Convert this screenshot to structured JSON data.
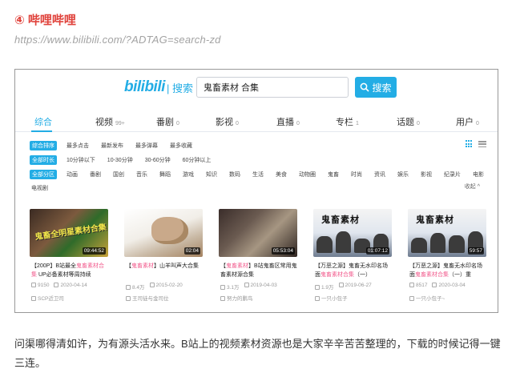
{
  "heading": "④ 哔哩哔哩",
  "url": "https://www.bilibili.com/?ADTAG=search-zd",
  "bilibili": {
    "logo": "bilibili",
    "logo_suffix": "| 搜索",
    "search": {
      "value": "鬼畜素材 合集",
      "button": "搜索"
    },
    "tabs": [
      {
        "label": "综合",
        "count": ""
      },
      {
        "label": "视频",
        "count": "99+"
      },
      {
        "label": "番剧",
        "count": "0"
      },
      {
        "label": "影视",
        "count": "0"
      },
      {
        "label": "直播",
        "count": "0"
      },
      {
        "label": "专栏",
        "count": "1"
      },
      {
        "label": "话题",
        "count": "0"
      },
      {
        "label": "用户",
        "count": "0"
      }
    ],
    "sort": [
      "综合排序",
      "最多点击",
      "最新发布",
      "最多弹幕",
      "最多收藏"
    ],
    "duration": [
      "全部时长",
      "10分钟以下",
      "10-30分钟",
      "30-60分钟",
      "60分钟以上"
    ],
    "zones": [
      "全部分区",
      "动画",
      "番剧",
      "国创",
      "音乐",
      "舞蹈",
      "游戏",
      "知识",
      "数码",
      "生活",
      "美食",
      "动物圈",
      "鬼畜",
      "时尚",
      "资讯",
      "娱乐",
      "影视",
      "纪录片",
      "电影"
    ],
    "more_zone": "电视剧",
    "collapse": "收起 ^",
    "videos": [
      {
        "title_pre": "【200P】B站最全",
        "title_hl": "鬼畜素材合集",
        "title_post": " UP必备素材等周持续",
        "duration": "09:44:52",
        "views": "9150",
        "date": "2020-04-14",
        "uploader": "SCP近卫司",
        "overlay": "鬼畜全明星素材合集"
      },
      {
        "title_pre": "【",
        "title_hl": "鬼畜素材",
        "title_post": "】山羊叫声大合集",
        "duration": "02:04",
        "views": "8.4万",
        "date": "2015-02-20",
        "uploader": "王司徒与金司位"
      },
      {
        "title_pre": "【",
        "title_hl": "鬼畜素材",
        "title_post": "】B站鬼畜区常用鬼畜素材源合集",
        "duration": "05:53:04",
        "views": "3.1万",
        "date": "2019-04-03",
        "uploader": "努力的鹏鸟"
      },
      {
        "title_pre": "【万恶之源】鬼畜无水印名场面",
        "title_hl": "鬼畜素材合集",
        "title_post": "（一）",
        "duration": "01:07:12",
        "views": "1.9万",
        "date": "2019-06-27",
        "uploader": "一只小包子",
        "overlay": "鬼畜素材"
      },
      {
        "title_pre": "【万恶之源】鬼畜无水印名场面",
        "title_hl": "鬼畜素材合集",
        "title_post": "（一）重",
        "duration": "59:57",
        "views": "8517",
        "date": "2020-03-04",
        "uploader": "一只小包子~",
        "overlay": "鬼畜素材"
      }
    ]
  },
  "paragraph": "问渠哪得清如许，为有源头活水来。B站上的视频素材资源也是大家辛辛苦苦整理的，下载的时候记得一键三连。"
}
